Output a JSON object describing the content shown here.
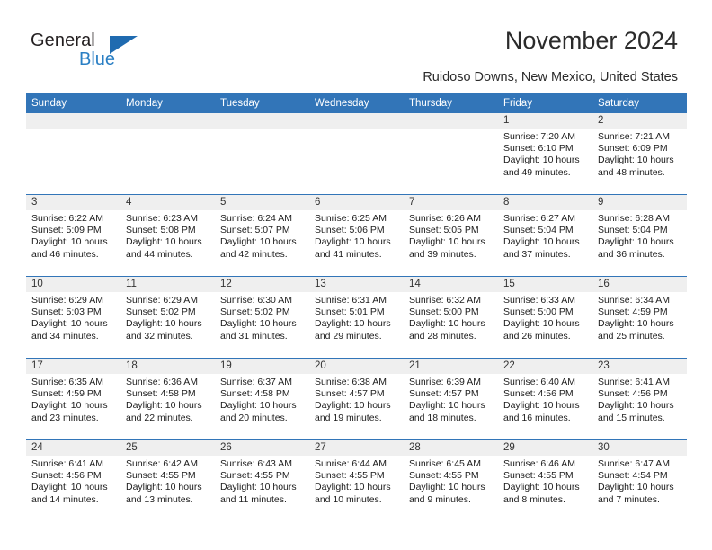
{
  "brand": {
    "name_part1": "General",
    "name_part2": "Blue",
    "triangle_color": "#1f6bb0"
  },
  "header": {
    "title": "November 2024",
    "location": "Ruidoso Downs, New Mexico, United States"
  },
  "theme": {
    "header_blue": "#3275b8",
    "daynum_band": "#efefef",
    "text": "#1c1c1c"
  },
  "weekday_headers": [
    "Sunday",
    "Monday",
    "Tuesday",
    "Wednesday",
    "Thursday",
    "Friday",
    "Saturday"
  ],
  "labels": {
    "sunrise": "Sunrise:",
    "sunset": "Sunset:",
    "daylight": "Daylight:"
  },
  "weeks": [
    [
      {
        "day": "",
        "empty": true
      },
      {
        "day": "",
        "empty": true
      },
      {
        "day": "",
        "empty": true
      },
      {
        "day": "",
        "empty": true
      },
      {
        "day": "",
        "empty": true
      },
      {
        "day": "1",
        "sunrise": "Sunrise: 7:20 AM",
        "sunset": "Sunset: 6:10 PM",
        "daylight_line1": "Daylight: 10 hours",
        "daylight_line2": "and 49 minutes."
      },
      {
        "day": "2",
        "sunrise": "Sunrise: 7:21 AM",
        "sunset": "Sunset: 6:09 PM",
        "daylight_line1": "Daylight: 10 hours",
        "daylight_line2": "and 48 minutes."
      }
    ],
    [
      {
        "day": "3",
        "sunrise": "Sunrise: 6:22 AM",
        "sunset": "Sunset: 5:09 PM",
        "daylight_line1": "Daylight: 10 hours",
        "daylight_line2": "and 46 minutes."
      },
      {
        "day": "4",
        "sunrise": "Sunrise: 6:23 AM",
        "sunset": "Sunset: 5:08 PM",
        "daylight_line1": "Daylight: 10 hours",
        "daylight_line2": "and 44 minutes."
      },
      {
        "day": "5",
        "sunrise": "Sunrise: 6:24 AM",
        "sunset": "Sunset: 5:07 PM",
        "daylight_line1": "Daylight: 10 hours",
        "daylight_line2": "and 42 minutes."
      },
      {
        "day": "6",
        "sunrise": "Sunrise: 6:25 AM",
        "sunset": "Sunset: 5:06 PM",
        "daylight_line1": "Daylight: 10 hours",
        "daylight_line2": "and 41 minutes."
      },
      {
        "day": "7",
        "sunrise": "Sunrise: 6:26 AM",
        "sunset": "Sunset: 5:05 PM",
        "daylight_line1": "Daylight: 10 hours",
        "daylight_line2": "and 39 minutes."
      },
      {
        "day": "8",
        "sunrise": "Sunrise: 6:27 AM",
        "sunset": "Sunset: 5:04 PM",
        "daylight_line1": "Daylight: 10 hours",
        "daylight_line2": "and 37 minutes."
      },
      {
        "day": "9",
        "sunrise": "Sunrise: 6:28 AM",
        "sunset": "Sunset: 5:04 PM",
        "daylight_line1": "Daylight: 10 hours",
        "daylight_line2": "and 36 minutes."
      }
    ],
    [
      {
        "day": "10",
        "sunrise": "Sunrise: 6:29 AM",
        "sunset": "Sunset: 5:03 PM",
        "daylight_line1": "Daylight: 10 hours",
        "daylight_line2": "and 34 minutes."
      },
      {
        "day": "11",
        "sunrise": "Sunrise: 6:29 AM",
        "sunset": "Sunset: 5:02 PM",
        "daylight_line1": "Daylight: 10 hours",
        "daylight_line2": "and 32 minutes."
      },
      {
        "day": "12",
        "sunrise": "Sunrise: 6:30 AM",
        "sunset": "Sunset: 5:02 PM",
        "daylight_line1": "Daylight: 10 hours",
        "daylight_line2": "and 31 minutes."
      },
      {
        "day": "13",
        "sunrise": "Sunrise: 6:31 AM",
        "sunset": "Sunset: 5:01 PM",
        "daylight_line1": "Daylight: 10 hours",
        "daylight_line2": "and 29 minutes."
      },
      {
        "day": "14",
        "sunrise": "Sunrise: 6:32 AM",
        "sunset": "Sunset: 5:00 PM",
        "daylight_line1": "Daylight: 10 hours",
        "daylight_line2": "and 28 minutes."
      },
      {
        "day": "15",
        "sunrise": "Sunrise: 6:33 AM",
        "sunset": "Sunset: 5:00 PM",
        "daylight_line1": "Daylight: 10 hours",
        "daylight_line2": "and 26 minutes."
      },
      {
        "day": "16",
        "sunrise": "Sunrise: 6:34 AM",
        "sunset": "Sunset: 4:59 PM",
        "daylight_line1": "Daylight: 10 hours",
        "daylight_line2": "and 25 minutes."
      }
    ],
    [
      {
        "day": "17",
        "sunrise": "Sunrise: 6:35 AM",
        "sunset": "Sunset: 4:59 PM",
        "daylight_line1": "Daylight: 10 hours",
        "daylight_line2": "and 23 minutes."
      },
      {
        "day": "18",
        "sunrise": "Sunrise: 6:36 AM",
        "sunset": "Sunset: 4:58 PM",
        "daylight_line1": "Daylight: 10 hours",
        "daylight_line2": "and 22 minutes."
      },
      {
        "day": "19",
        "sunrise": "Sunrise: 6:37 AM",
        "sunset": "Sunset: 4:58 PM",
        "daylight_line1": "Daylight: 10 hours",
        "daylight_line2": "and 20 minutes."
      },
      {
        "day": "20",
        "sunrise": "Sunrise: 6:38 AM",
        "sunset": "Sunset: 4:57 PM",
        "daylight_line1": "Daylight: 10 hours",
        "daylight_line2": "and 19 minutes."
      },
      {
        "day": "21",
        "sunrise": "Sunrise: 6:39 AM",
        "sunset": "Sunset: 4:57 PM",
        "daylight_line1": "Daylight: 10 hours",
        "daylight_line2": "and 18 minutes."
      },
      {
        "day": "22",
        "sunrise": "Sunrise: 6:40 AM",
        "sunset": "Sunset: 4:56 PM",
        "daylight_line1": "Daylight: 10 hours",
        "daylight_line2": "and 16 minutes."
      },
      {
        "day": "23",
        "sunrise": "Sunrise: 6:41 AM",
        "sunset": "Sunset: 4:56 PM",
        "daylight_line1": "Daylight: 10 hours",
        "daylight_line2": "and 15 minutes."
      }
    ],
    [
      {
        "day": "24",
        "sunrise": "Sunrise: 6:41 AM",
        "sunset": "Sunset: 4:56 PM",
        "daylight_line1": "Daylight: 10 hours",
        "daylight_line2": "and 14 minutes."
      },
      {
        "day": "25",
        "sunrise": "Sunrise: 6:42 AM",
        "sunset": "Sunset: 4:55 PM",
        "daylight_line1": "Daylight: 10 hours",
        "daylight_line2": "and 13 minutes."
      },
      {
        "day": "26",
        "sunrise": "Sunrise: 6:43 AM",
        "sunset": "Sunset: 4:55 PM",
        "daylight_line1": "Daylight: 10 hours",
        "daylight_line2": "and 11 minutes."
      },
      {
        "day": "27",
        "sunrise": "Sunrise: 6:44 AM",
        "sunset": "Sunset: 4:55 PM",
        "daylight_line1": "Daylight: 10 hours",
        "daylight_line2": "and 10 minutes."
      },
      {
        "day": "28",
        "sunrise": "Sunrise: 6:45 AM",
        "sunset": "Sunset: 4:55 PM",
        "daylight_line1": "Daylight: 10 hours",
        "daylight_line2": "and 9 minutes."
      },
      {
        "day": "29",
        "sunrise": "Sunrise: 6:46 AM",
        "sunset": "Sunset: 4:55 PM",
        "daylight_line1": "Daylight: 10 hours",
        "daylight_line2": "and 8 minutes."
      },
      {
        "day": "30",
        "sunrise": "Sunrise: 6:47 AM",
        "sunset": "Sunset: 4:54 PM",
        "daylight_line1": "Daylight: 10 hours",
        "daylight_line2": "and 7 minutes."
      }
    ]
  ]
}
